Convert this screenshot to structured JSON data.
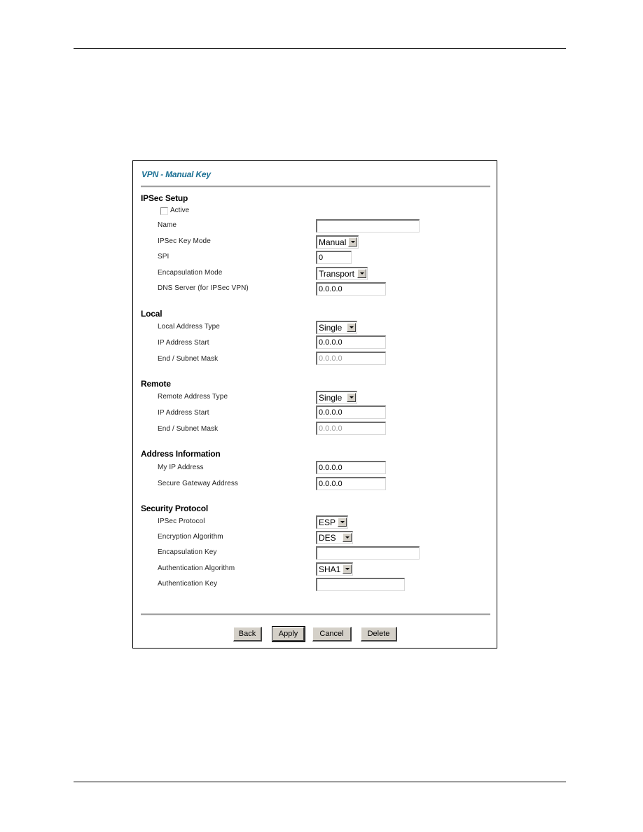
{
  "panel": {
    "title": "VPN - Manual Key"
  },
  "ipsec_setup": {
    "heading": "IPSec Setup",
    "active_label": "Active",
    "active_checked": false,
    "name_label": "Name",
    "name_value": "",
    "key_mode_label": "IPSec Key Mode",
    "key_mode_value": "Manual",
    "spi_label": "SPI",
    "spi_value": "0",
    "encapsulation_mode_label": "Encapsulation Mode",
    "encapsulation_mode_value": "Transport",
    "dns_label": "DNS Server (for IPSec VPN)",
    "dns_value": "0.0.0.0"
  },
  "local": {
    "heading": "Local",
    "address_type_label": "Local Address Type",
    "address_type_value": "Single",
    "ip_start_label": "IP Address Start",
    "ip_start_value": "0.0.0.0",
    "end_mask_label": "End / Subnet Mask",
    "end_mask_value": "0.0.0.0"
  },
  "remote": {
    "heading": "Remote",
    "address_type_label": "Remote Address Type",
    "address_type_value": "Single",
    "ip_start_label": "IP Address Start",
    "ip_start_value": "0.0.0.0",
    "end_mask_label": "End / Subnet Mask",
    "end_mask_value": "0.0.0.0"
  },
  "address_info": {
    "heading": "Address Information",
    "my_ip_label": "My IP Address",
    "my_ip_value": "0.0.0.0",
    "gateway_label": "Secure Gateway Address",
    "gateway_value": "0.0.0.0"
  },
  "security": {
    "heading": "Security Protocol",
    "protocol_label": "IPSec Protocol",
    "protocol_value": "ESP",
    "encryption_label": "Encryption Algorithm",
    "encryption_value": "DES",
    "encap_key_label": "Encapsulation Key",
    "encap_key_value": "",
    "auth_algo_label": "Authentication Algorithm",
    "auth_algo_value": "SHA1",
    "auth_key_label": "Authentication Key",
    "auth_key_value": ""
  },
  "buttons": {
    "back": "Back",
    "apply": "Apply",
    "cancel": "Cancel",
    "delete": "Delete"
  }
}
